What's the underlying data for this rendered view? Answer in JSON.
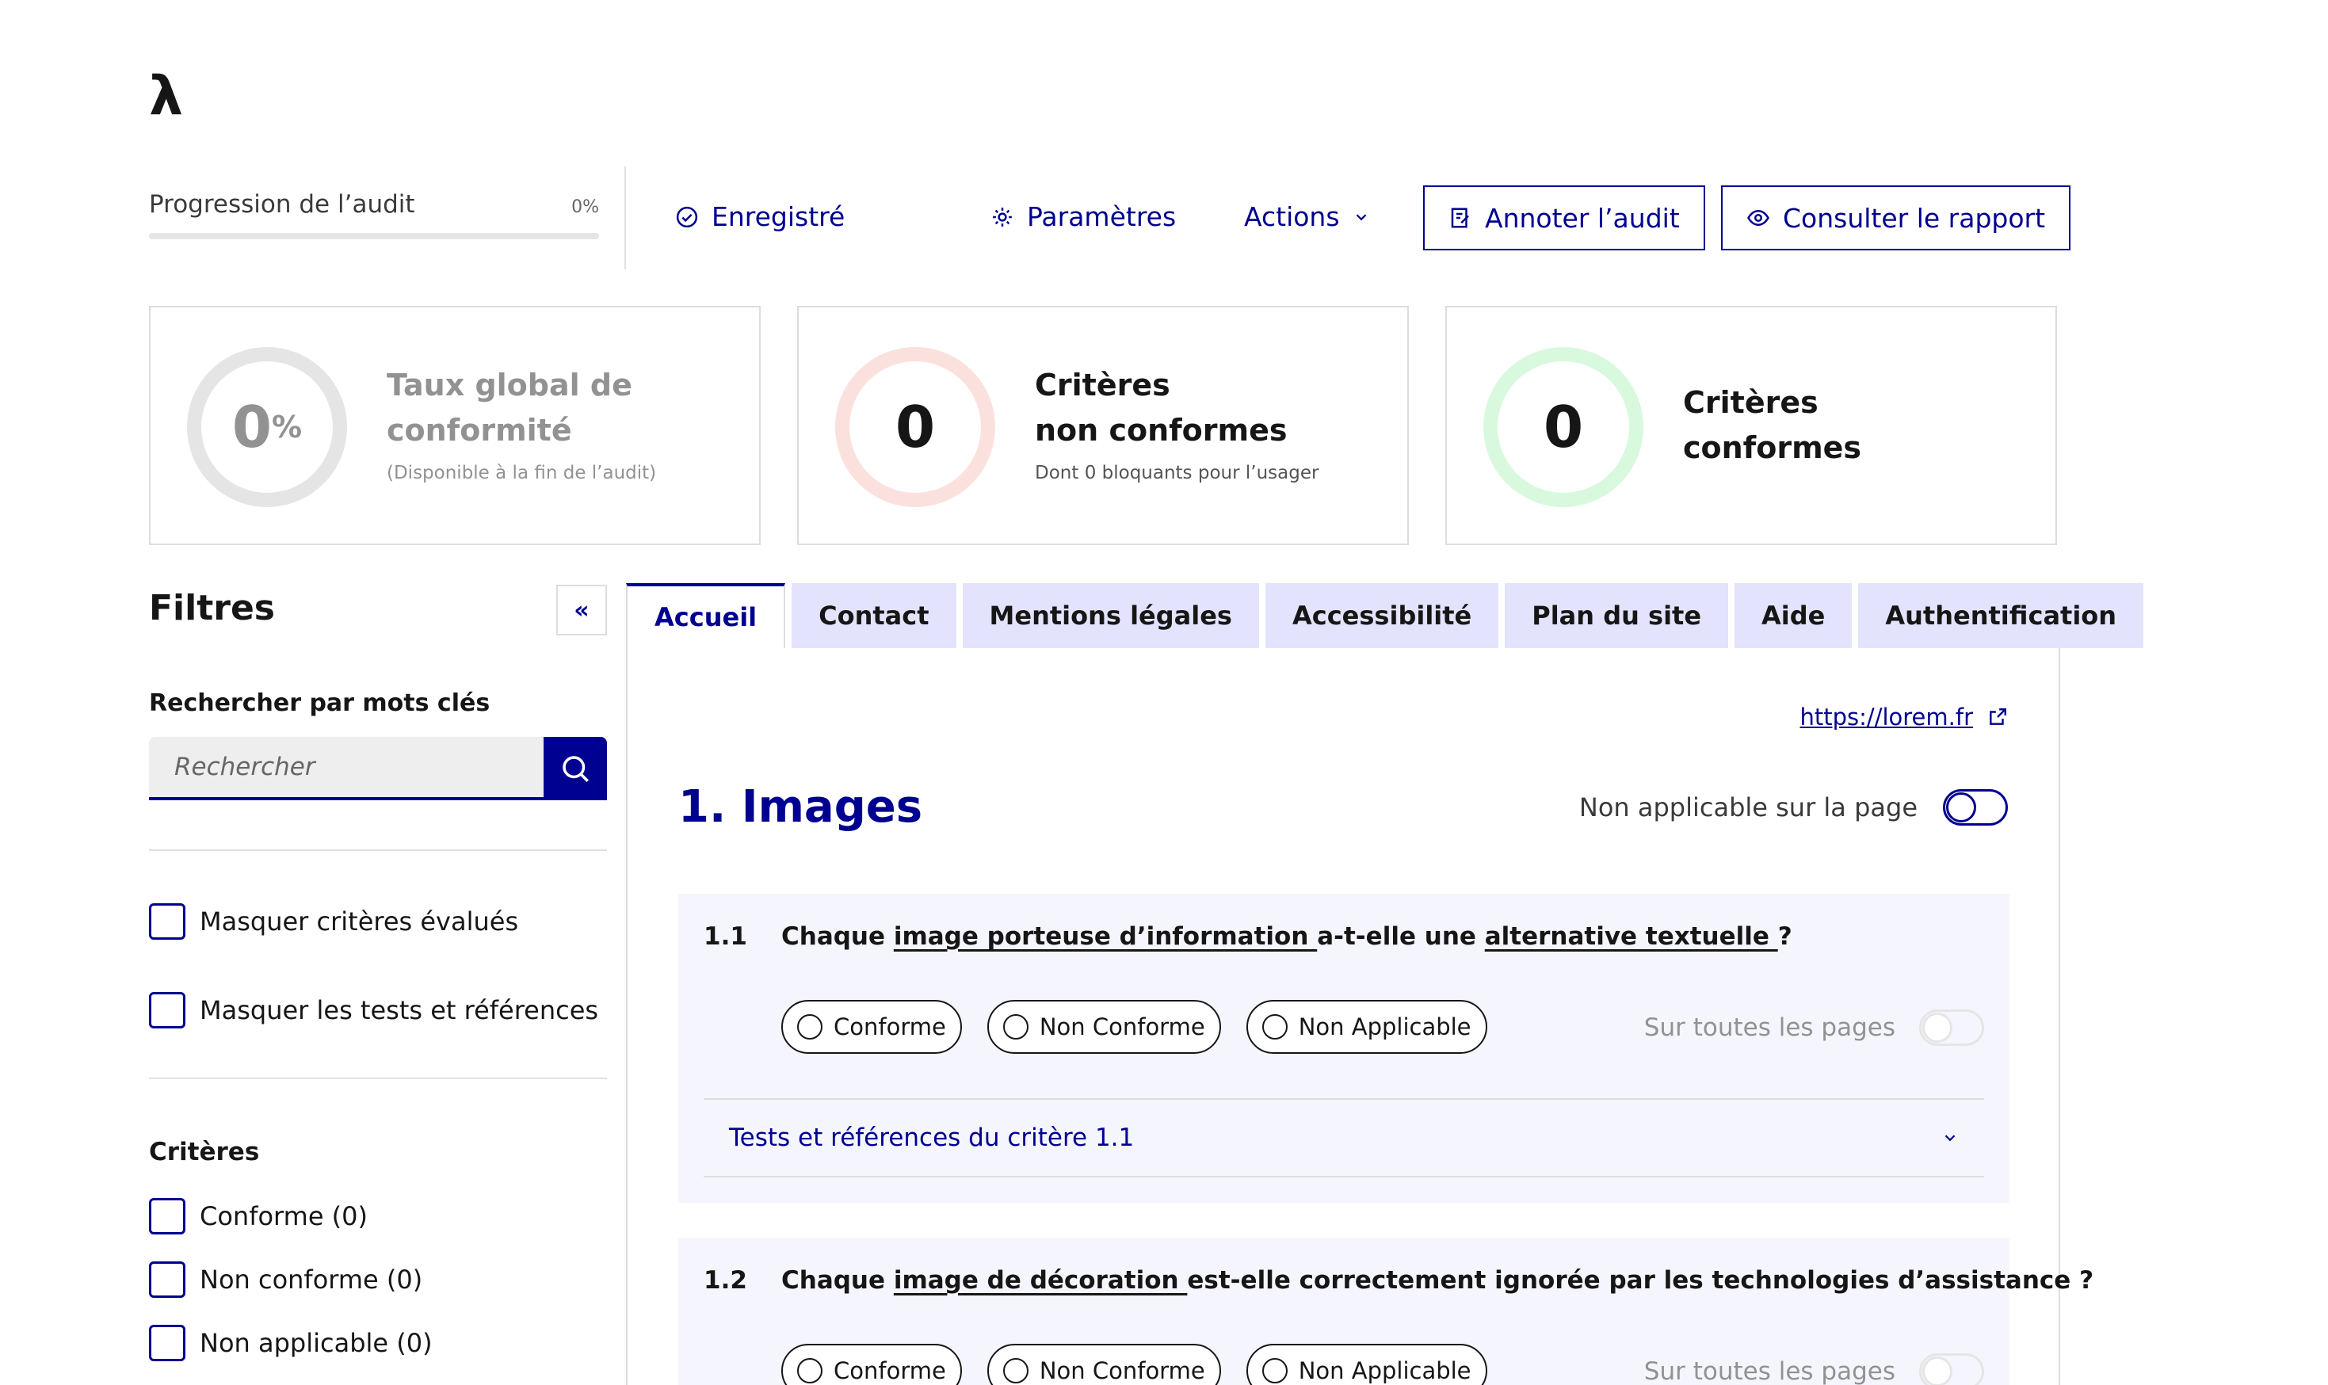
{
  "logo": "λ",
  "progress": {
    "label": "Progression de l’audit",
    "value": "0%",
    "fraction": 0
  },
  "toolbar": {
    "saved": "Enregistré",
    "settings": "Paramètres",
    "actions": "Actions",
    "annotate": "Annoter l’audit",
    "report": "Consulter le rapport"
  },
  "stats": [
    {
      "number": "0",
      "suffix": "%",
      "title": "Taux global de conformité",
      "subtitle": "(Disponible à la fin de l’audit)",
      "ring_color": "#e5e5e5"
    },
    {
      "number": "0",
      "title_line1": "Critères",
      "title_line2": "non conformes",
      "subtitle": "Dont 0 bloquants pour l’usager",
      "ring_color": "#fbe1dd"
    },
    {
      "number": "0",
      "title_line1": "Critères",
      "title_line2": "conformes",
      "ring_color": "#d8f9dd"
    }
  ],
  "filters": {
    "title": "Filtres",
    "collapse": "«",
    "search_label": "Rechercher par mots clés",
    "search_placeholder": "Rechercher",
    "hide_evaluated": "Masquer critères évalués",
    "hide_tests": "Masquer les tests et références",
    "criteria_label": "Critères",
    "criteria": [
      "Conforme (0)",
      "Non conforme (0)",
      "Non applicable (0)"
    ]
  },
  "tabs": [
    "Accueil",
    "Contact",
    "Mentions légales",
    "Accessibilité",
    "Plan du site",
    "Aide",
    "Authentification"
  ],
  "page": {
    "url": "https://lorem.fr",
    "section_title": "1. Images",
    "not_applicable_label": "Non applicable sur la page"
  },
  "criteria_items": [
    {
      "num": "1.1",
      "q_pre": "Chaque ",
      "q_link1": "image porteuse d’information ",
      "q_mid": "a-t-elle une ",
      "q_link2": "alternative textuelle ",
      "q_post": " ?",
      "accordion": "Tests et références du critère 1.1"
    },
    {
      "num": "1.2",
      "q_pre": "Chaque ",
      "q_link1": "image de décoration ",
      "q_mid": "est-elle correctement ignorée par les technologies d’assistance ?"
    }
  ],
  "radio_labels": {
    "conforme": "Conforme",
    "non_conforme": "Non Conforme",
    "non_applicable": "Non Applicable"
  },
  "all_pages_label": "Sur toutes les pages",
  "colors": {
    "primary": "#000091",
    "tab_bg": "#e3e3fd",
    "criterion_bg": "#f5f5fe"
  }
}
